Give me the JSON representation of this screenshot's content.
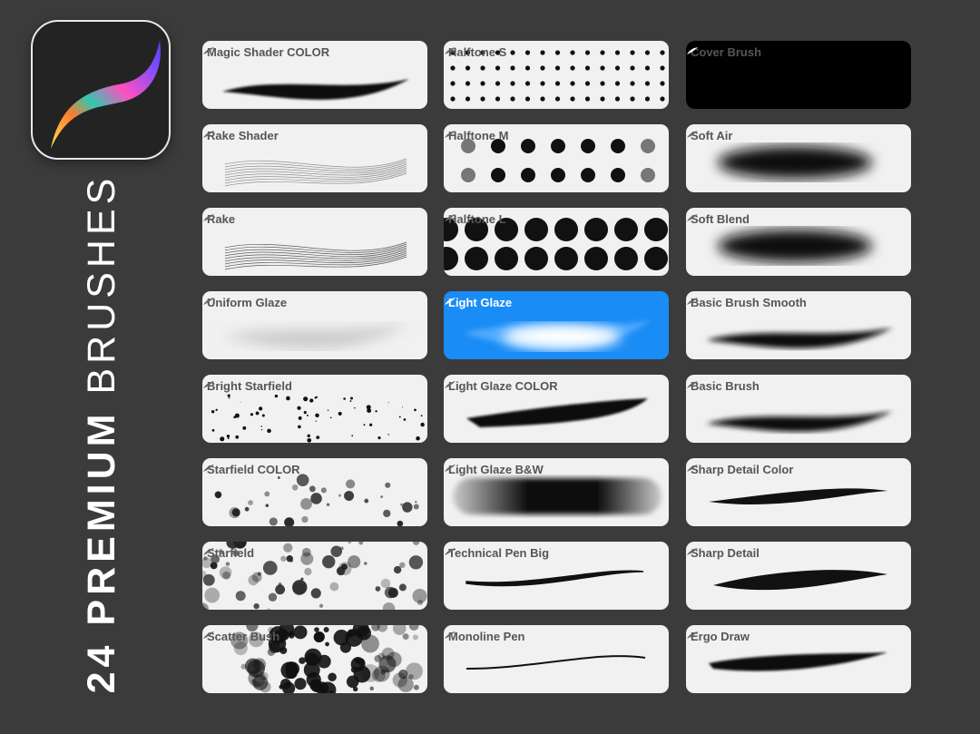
{
  "title": {
    "count": "24",
    "bold": "PREMIUM",
    "light": "BRUSHES"
  },
  "logo": "procreate-logo",
  "colors": {
    "background": "#3b3b3b",
    "card": "#f1f1f1",
    "selected": "#1a8cf5",
    "label": "#555555"
  },
  "brushes": [
    {
      "name": "Magic Shader COLOR",
      "preview": "grainy-stroke"
    },
    {
      "name": "Rake Shader",
      "preview": "rake-light"
    },
    {
      "name": "Rake",
      "preview": "rake"
    },
    {
      "name": "Uniform Glaze",
      "preview": "glaze"
    },
    {
      "name": "Bright Starfield",
      "preview": "starfield-small"
    },
    {
      "name": "Starfield COLOR",
      "preview": "starfield-color"
    },
    {
      "name": "Starfield",
      "preview": "starfield"
    },
    {
      "name": "Scatter Bush",
      "preview": "scatter"
    },
    {
      "name": "Halftone S",
      "preview": "halftone-s"
    },
    {
      "name": "Halftone M",
      "preview": "halftone-m"
    },
    {
      "name": "Halftone L",
      "preview": "halftone-l"
    },
    {
      "name": "Light Glaze",
      "preview": "light-glaze",
      "selected": true
    },
    {
      "name": "Light Glaze COLOR",
      "preview": "glaze-color"
    },
    {
      "name": "Light Glaze B&W",
      "preview": "glaze-bw"
    },
    {
      "name": "Technical Pen Big",
      "preview": "pen-big"
    },
    {
      "name": "Monoline Pen",
      "preview": "monoline"
    },
    {
      "name": "Cover Brush",
      "preview": "solid"
    },
    {
      "name": "Soft Air",
      "preview": "soft"
    },
    {
      "name": "Soft Blend",
      "preview": "soft"
    },
    {
      "name": "Basic Brush Smooth",
      "preview": "basic"
    },
    {
      "name": "Basic Brush",
      "preview": "basic"
    },
    {
      "name": "Sharp Detail Color",
      "preview": "sharp"
    },
    {
      "name": "Sharp Detail",
      "preview": "sharp-thick"
    },
    {
      "name": "Ergo Draw",
      "preview": "ergo"
    }
  ]
}
